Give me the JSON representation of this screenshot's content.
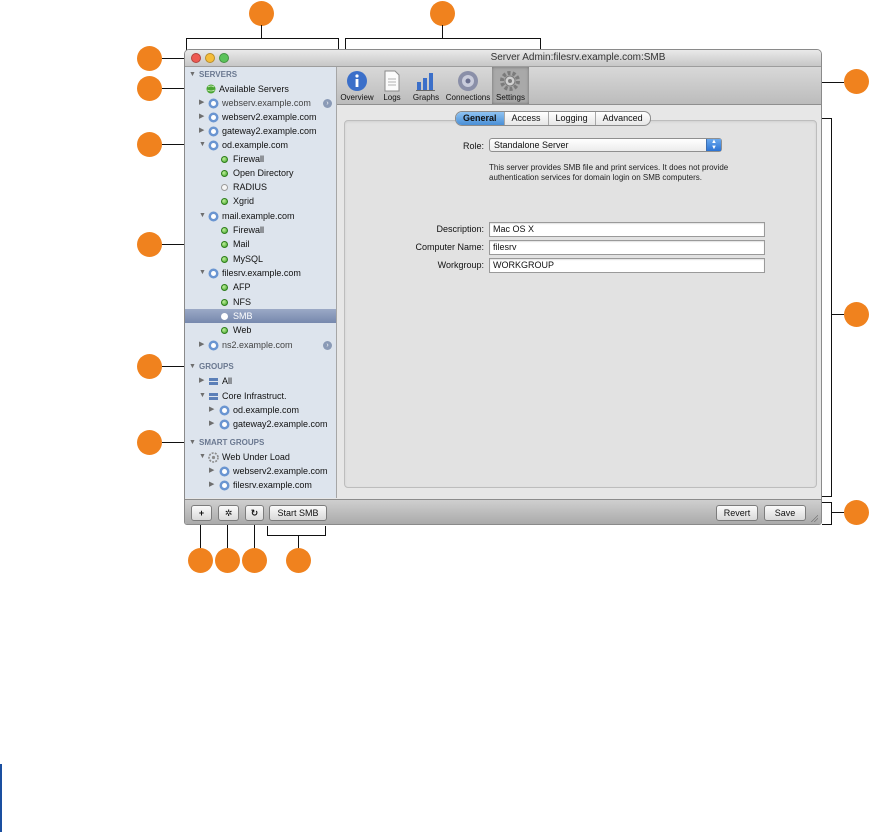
{
  "window": {
    "title": "Server Admin:filesrv.example.com:SMB"
  },
  "colors": {
    "callout": "#f0821e",
    "sidebar_bg": "#dde4ed",
    "selection": "#7688ad",
    "status_green": "#3fa428",
    "close": "#ee5a52",
    "minimize": "#f5bd3a",
    "zoom": "#5bc35a"
  },
  "sidebar": {
    "sections": {
      "servers": "SERVERS",
      "groups": "GROUPS",
      "smart_groups": "SMART GROUPS"
    },
    "available_servers": "Available Servers",
    "servers": [
      {
        "name": "webserv.example.com"
      },
      {
        "name": "webserv2.example.com"
      },
      {
        "name": "gateway2.example.com"
      },
      {
        "name": "od.example.com",
        "services": [
          "Firewall",
          "Open Directory",
          "RADIUS",
          "Xgrid"
        ]
      },
      {
        "name": "mail.example.com",
        "services": [
          "Firewall",
          "Mail",
          "MySQL"
        ]
      },
      {
        "name": "filesrv.example.com",
        "services": [
          "AFP",
          "NFS",
          "SMB",
          "Web"
        ]
      },
      {
        "name": "ns2.example.com"
      }
    ],
    "groups": [
      {
        "name": "All"
      },
      {
        "name": "Core Infrastruct.",
        "members": [
          "od.example.com",
          "gateway2.example.com"
        ]
      }
    ],
    "smart_groups": [
      {
        "name": "Web Under Load",
        "members": [
          "webserv2.example.com",
          "filesrv.example.com"
        ]
      }
    ]
  },
  "toolbar": {
    "items": [
      "Overview",
      "Logs",
      "Graphs",
      "Connections",
      "Settings"
    ],
    "selected": "Settings"
  },
  "settings": {
    "tabs": [
      "General",
      "Access",
      "Logging",
      "Advanced"
    ],
    "selected_tab": "General",
    "role_label": "Role:",
    "role_value": "Standalone Server",
    "role_help": "This server provides SMB file and print services. It does not provide authentication services for domain login on SMB computers.",
    "description_label": "Description:",
    "description_value": "Mac OS X",
    "computer_name_label": "Computer Name:",
    "computer_name_value": "filesrv",
    "workgroup_label": "Workgroup:",
    "workgroup_value": "WORKGROUP"
  },
  "bottom_bar": {
    "add_glyph": "+",
    "action_glyph": "✲",
    "refresh_glyph": "↻",
    "start_service": "Start SMB",
    "revert": "Revert",
    "save": "Save"
  }
}
